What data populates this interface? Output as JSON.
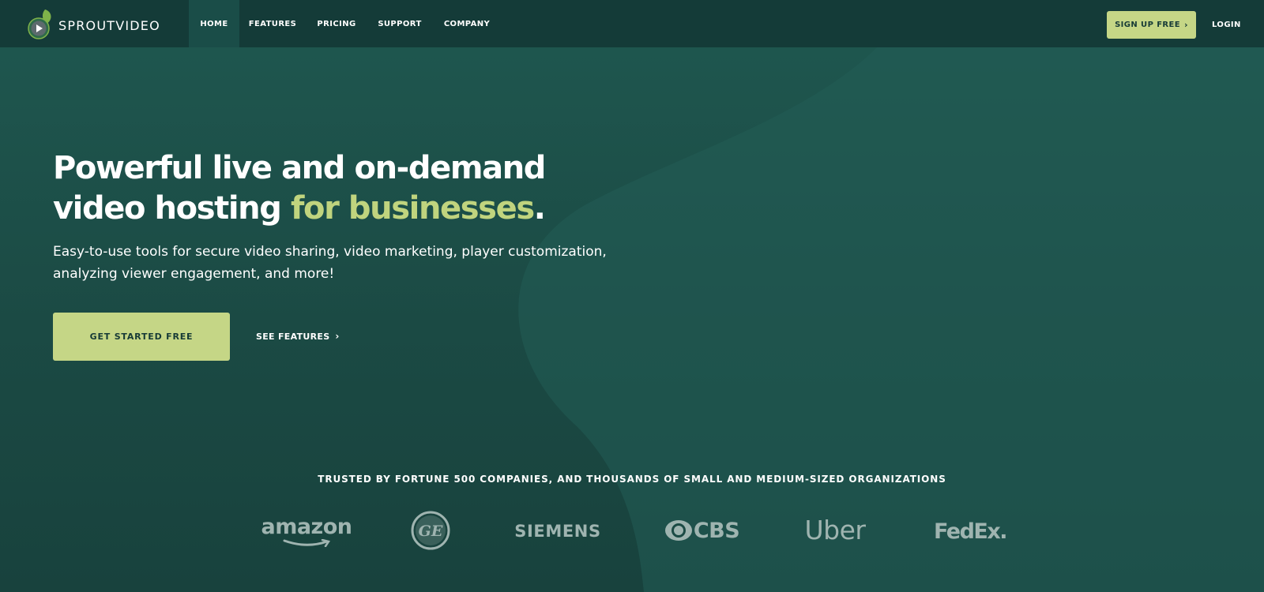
{
  "brand": {
    "name": "SPROUTVIDEO",
    "logo_icon": "sprout-play-icon"
  },
  "nav": {
    "items": [
      {
        "label": "HOME",
        "active": true
      },
      {
        "label": "FEATURES",
        "active": false
      },
      {
        "label": "PRICING",
        "active": false
      },
      {
        "label": "SUPPORT",
        "active": false
      },
      {
        "label": "COMPANY",
        "active": false
      }
    ],
    "signup_label": "SIGN UP FREE",
    "signup_icon": "chevron-right-icon",
    "login_label": "LOGIN"
  },
  "hero": {
    "headline_line1": "Powerful live and on-demand",
    "headline_line2_prefix": "video hosting ",
    "headline_line2_accent": "for businesses",
    "headline_line2_suffix": ".",
    "subtitle": "Easy-to-use tools for secure video sharing, video marketing, player customization, analyzing viewer engagement, and more!",
    "cta_label": "GET STARTED FREE",
    "secondary_label": "SEE FEATURES",
    "secondary_icon": "chevron-right-icon"
  },
  "trusted": {
    "heading": "TRUSTED BY FORTUNE 500 COMPANIES, AND THOUSANDS OF SMALL AND MEDIUM-SIZED ORGANIZATIONS",
    "logos": [
      "amazon",
      "GE",
      "SIEMENS",
      "CBS",
      "Uber",
      "FedEx."
    ]
  },
  "colors": {
    "background": "#1d4e48",
    "nav_background": "#143b38",
    "accent_green": "#c5d686",
    "headline_accent": "#c0d47e",
    "logo_gray": "#9fb4b0"
  }
}
